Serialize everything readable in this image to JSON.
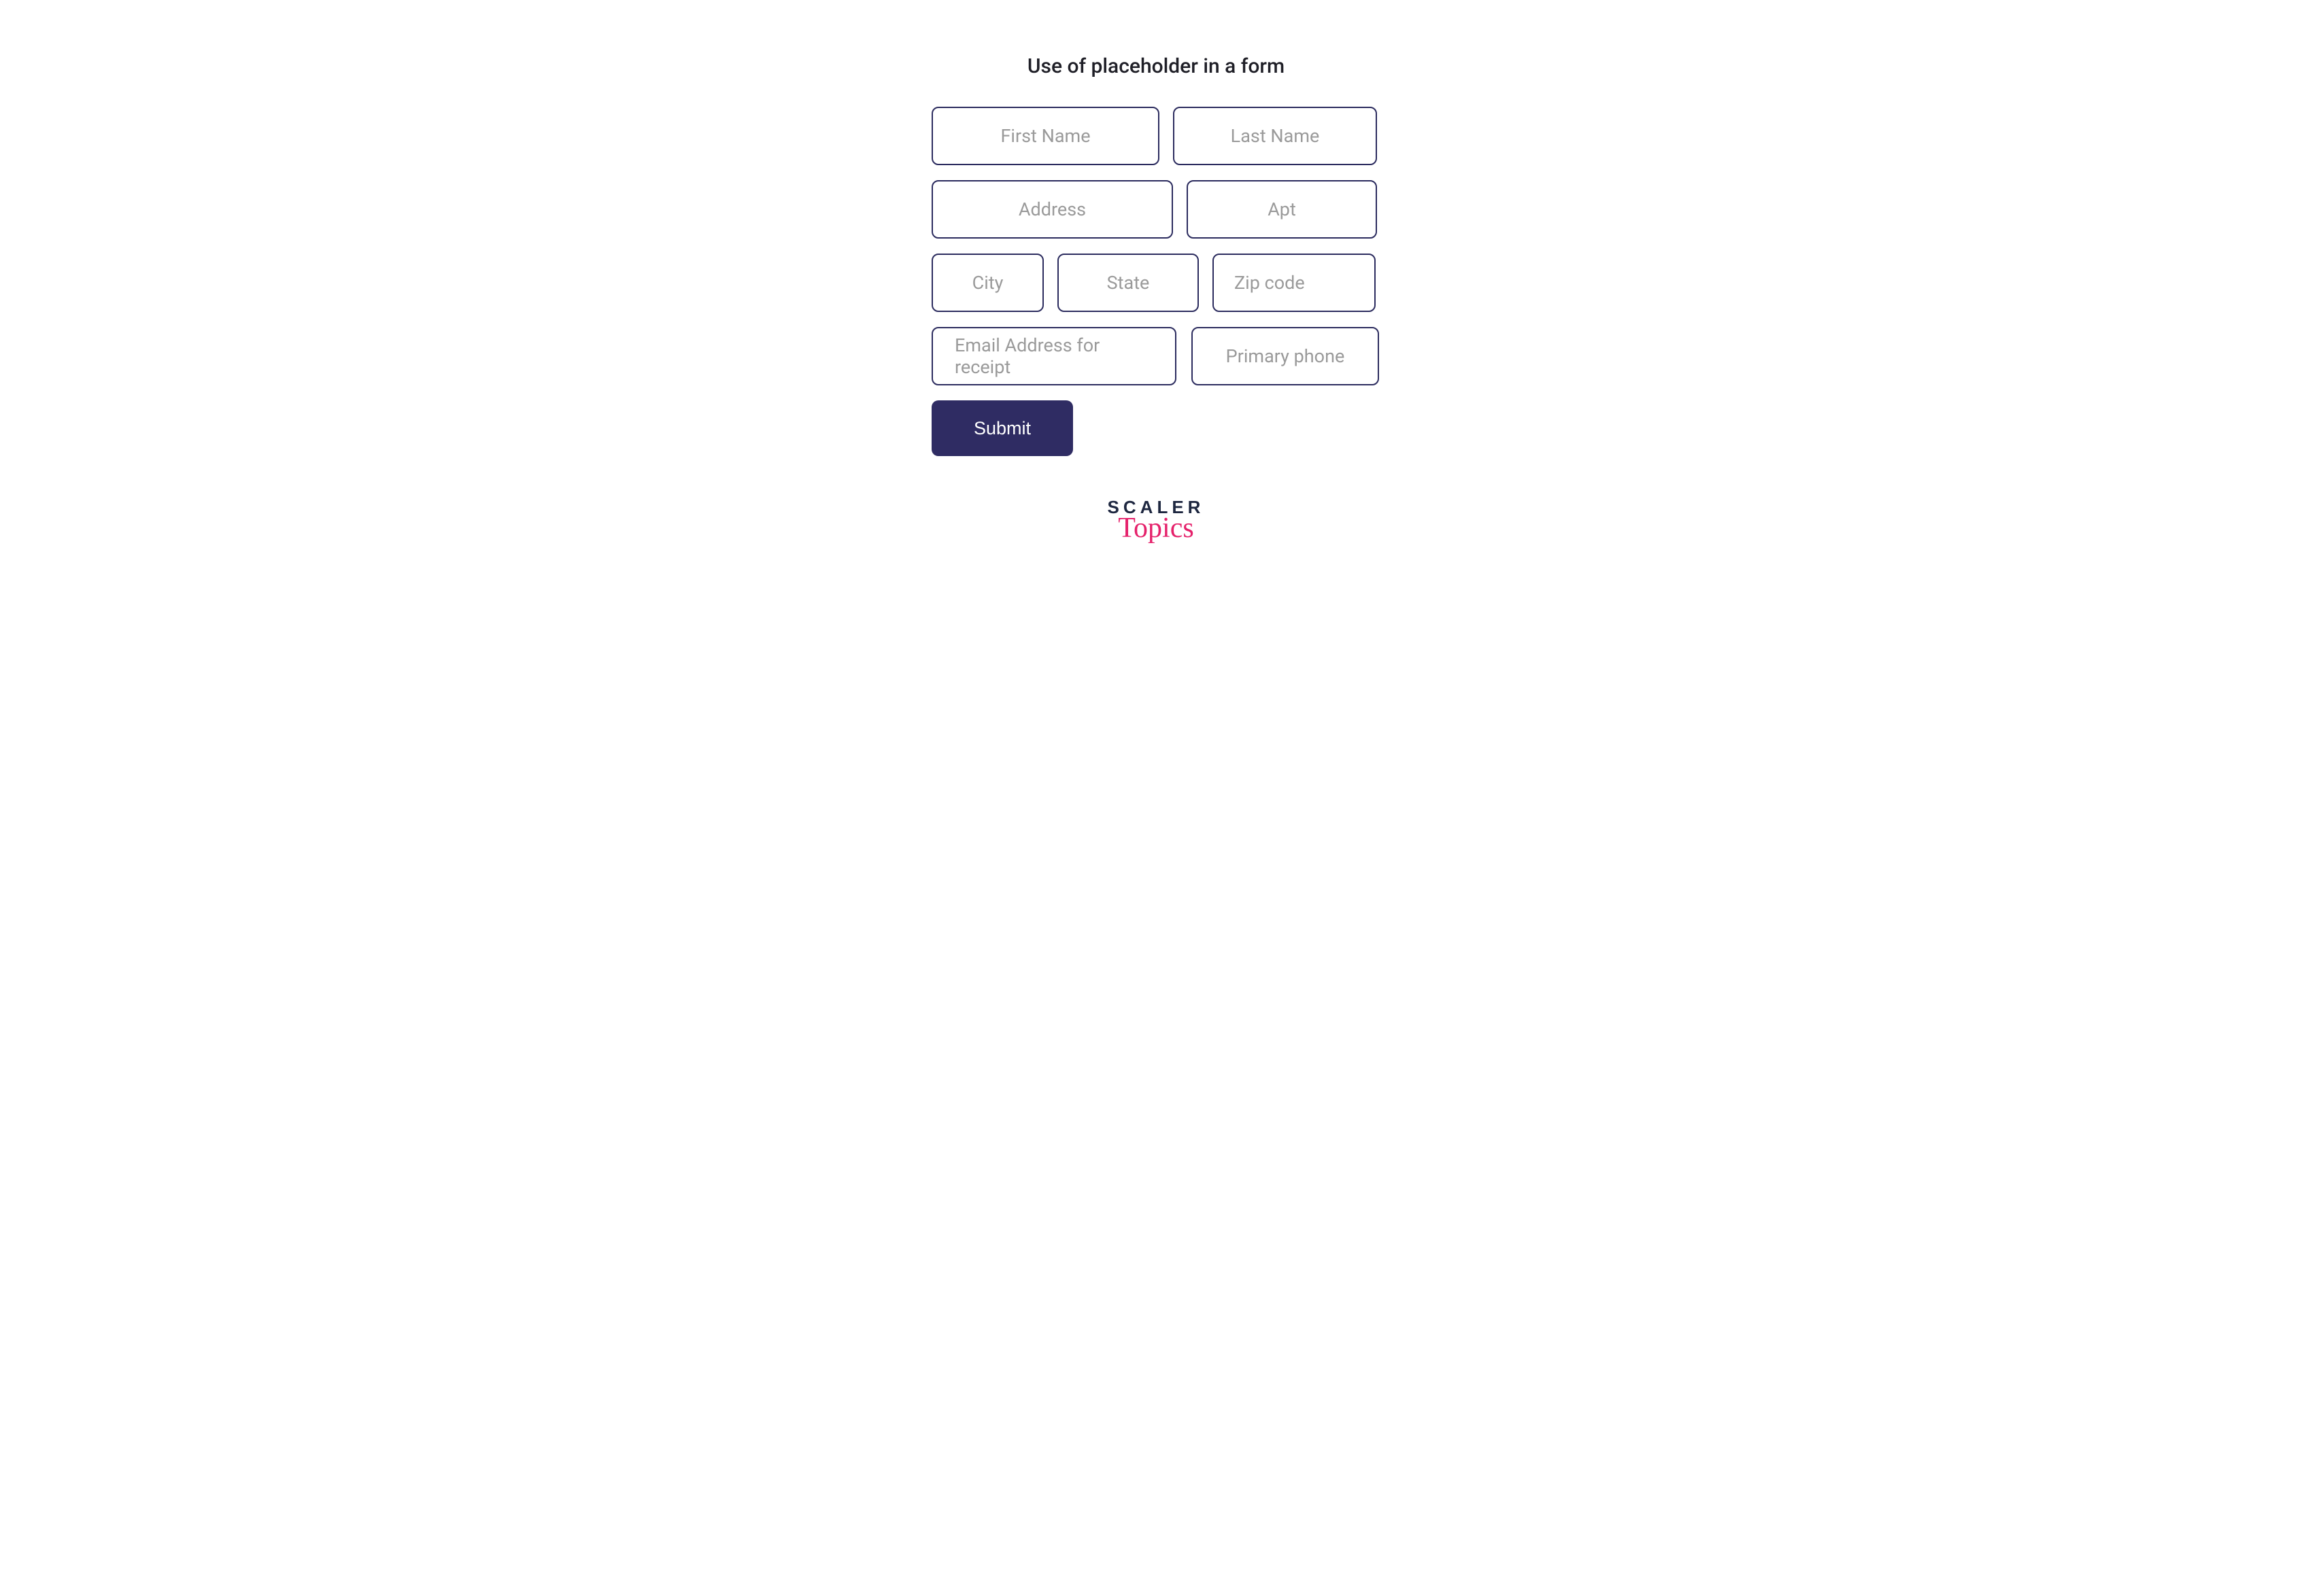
{
  "title": "Use of placeholder in a form",
  "fields": {
    "first_name": "First Name",
    "last_name": "Last Name",
    "address": "Address",
    "apt": "Apt",
    "city": "City",
    "state": "State",
    "zip": "Zip code",
    "email": "Email Address for receipt",
    "phone": "Primary phone"
  },
  "submit_label": "Submit",
  "logo": {
    "line1": "SCALER",
    "line2": "Topics"
  },
  "colors": {
    "border": "#2b2b5e",
    "placeholder": "#9a9a9a",
    "button_bg": "#2f2c63",
    "button_text": "#ffffff",
    "logo_dark": "#1e2740",
    "logo_pink": "#e5216b"
  }
}
